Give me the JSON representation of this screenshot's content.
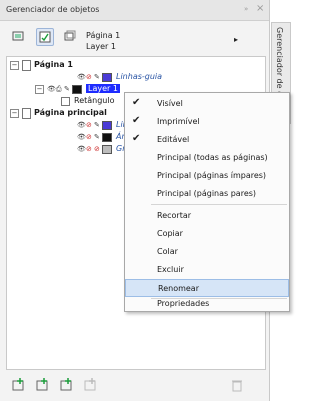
{
  "panel": {
    "title": "Gerenciador de objetos",
    "pin_glyph": "»",
    "close_glyph": "×",
    "vertical_tab": "Gerenciador de objetos",
    "page_info": {
      "page": "Página 1",
      "layer": "Layer 1",
      "arrow": "▸"
    }
  },
  "tree": {
    "page1": {
      "label": "Página 1",
      "expander": "−"
    },
    "guides": {
      "label": "Linhas-guia"
    },
    "layer1": {
      "label": "Layer 1",
      "expander": "−"
    },
    "rect": {
      "label": "Retângulo"
    },
    "master": {
      "label": "Página principal",
      "expander": "−"
    },
    "m_guides": {
      "label": "Linhas-g"
    },
    "m_desktop": {
      "label": "Área de"
    },
    "m_grid": {
      "label": "Grade"
    }
  },
  "context_menu": {
    "items": [
      {
        "label": "Visível",
        "checked": "✔"
      },
      {
        "label": "Imprimível",
        "checked": "✔"
      },
      {
        "label": "Editável",
        "checked": "✔"
      },
      {
        "label": "Principal (todas as páginas)"
      },
      {
        "label": "Principal (páginas ímpares)"
      },
      {
        "label": "Principal (páginas pares)"
      },
      {
        "label": "Recortar"
      },
      {
        "label": "Copiar"
      },
      {
        "label": "Colar"
      },
      {
        "label": "Excluir"
      },
      {
        "label": "Renomear"
      },
      {
        "label": "Propriedades"
      }
    ]
  },
  "colors": {
    "layer_blue": "#1e2cff",
    "guides_swatch": "#4b3bd6",
    "desktop_swatch": "#111111",
    "grid_swatch": "#bdbdbd",
    "highlight": "#d6e5f7",
    "eye_red": "#cc2a2a"
  }
}
